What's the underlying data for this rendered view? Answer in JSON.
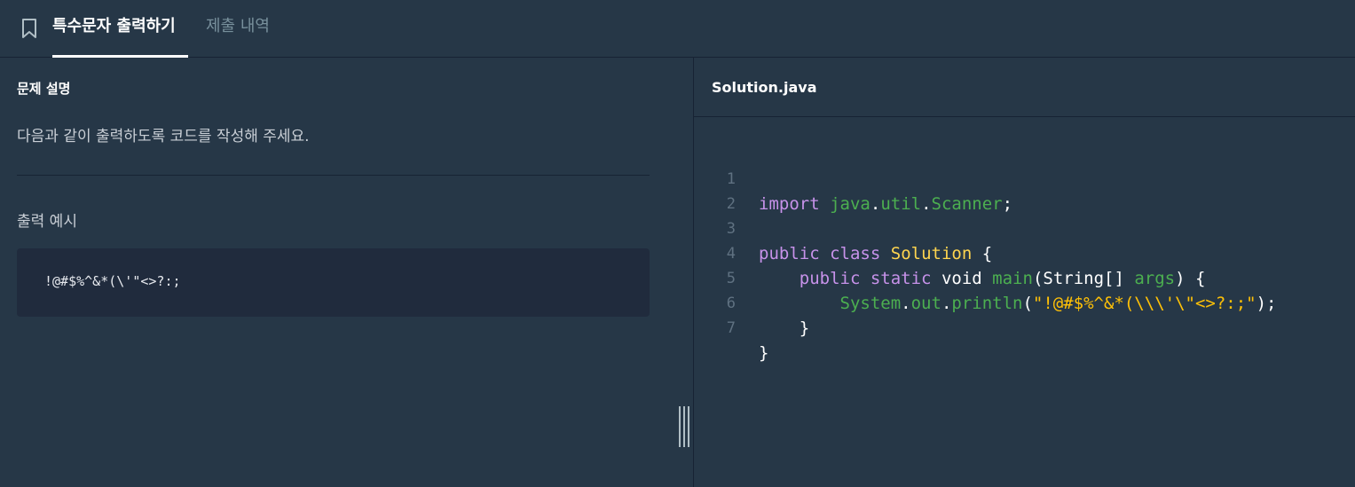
{
  "header": {
    "active_tab": "특수문자 출력하기",
    "inactive_tab": "제출 내역"
  },
  "problem": {
    "section_title": "문제 설명",
    "description": "다음과 같이 출력하도록 코드를 작성해 주세요.",
    "example_title": "출력 예시",
    "example_output": "!@#$%^&*(\\'\"<>?:;"
  },
  "editor": {
    "file_name": "Solution.java",
    "line_numbers": [
      "1",
      "2",
      "3",
      "4",
      "5",
      "6",
      "7"
    ],
    "tokens": {
      "import": "import",
      "java": "java",
      "util": "util",
      "scanner": "Scanner",
      "public": "public",
      "class": "class",
      "solution": "Solution",
      "static": "static",
      "void": "void",
      "main": "main",
      "string_type": "String",
      "args": "args",
      "system": "System",
      "out": "out",
      "println": "println",
      "string_literal": "\"!@#$%^&*(\\\\\\'\\\"<>?:;\""
    }
  },
  "colors": {
    "background": "#263747",
    "border": "#172334",
    "keyword": "#c792ea",
    "package": "#4caf50",
    "class_name": "#ffd54f",
    "string": "#ffc107"
  }
}
